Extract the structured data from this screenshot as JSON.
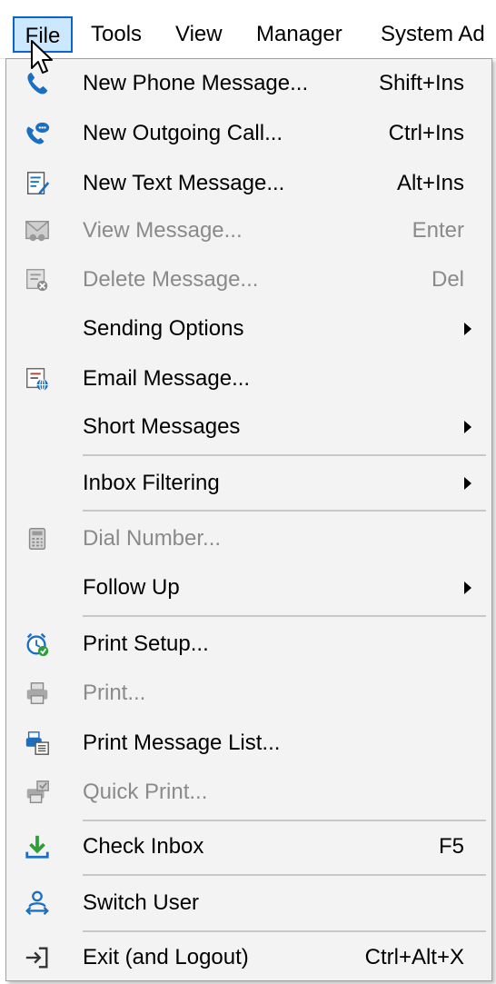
{
  "menubar": {
    "items": [
      "File",
      "Tools",
      "View",
      "Manager",
      "System Ad"
    ]
  },
  "colors": {
    "accent": "#0a64c9",
    "highlight": "#cce8ff",
    "disabled_text": "#8a8a8a",
    "icon_blue": "#1a6fc2",
    "icon_green": "#2e9d3a"
  },
  "menu": {
    "items": [
      {
        "label": "New Phone Message...",
        "shortcut": "Shift+Ins",
        "icon": "phone-icon",
        "enabled": true
      },
      {
        "label": "New Outgoing Call...",
        "shortcut": "Ctrl+Ins",
        "icon": "outgoing-call-icon",
        "enabled": true
      },
      {
        "label": "New Text Message...",
        "shortcut": "Alt+Ins",
        "icon": "text-message-icon",
        "enabled": true
      },
      {
        "label": "View Message...",
        "shortcut": "Enter",
        "icon": "view-message-icon",
        "enabled": false
      },
      {
        "label": "Delete Message...",
        "shortcut": "Del",
        "icon": "delete-message-icon",
        "enabled": false
      },
      {
        "label": "Sending Options",
        "shortcut": "",
        "icon": "",
        "enabled": true,
        "submenu": true
      },
      {
        "label": "Email Message...",
        "shortcut": "",
        "icon": "email-message-icon",
        "enabled": true
      },
      {
        "label": "Short Messages",
        "shortcut": "",
        "icon": "",
        "enabled": true,
        "submenu": true
      },
      {
        "label": "Inbox Filtering",
        "shortcut": "",
        "icon": "",
        "enabled": true,
        "submenu": true
      },
      {
        "label": "Dial Number...",
        "shortcut": "",
        "icon": "dial-pad-icon",
        "enabled": false
      },
      {
        "label": "Follow Up",
        "shortcut": "",
        "icon": "",
        "enabled": true,
        "submenu": true
      },
      {
        "label": "Print Setup...",
        "shortcut": "",
        "icon": "alarm-clock-icon",
        "enabled": true
      },
      {
        "label": "Print...",
        "shortcut": "",
        "icon": "printer-icon",
        "enabled": false
      },
      {
        "label": "Print Message List...",
        "shortcut": "",
        "icon": "print-list-icon",
        "enabled": true
      },
      {
        "label": "Quick Print...",
        "shortcut": "",
        "icon": "quick-print-icon",
        "enabled": false
      },
      {
        "label": "Check Inbox",
        "shortcut": "F5",
        "icon": "download-icon",
        "enabled": true
      },
      {
        "label": "Switch User",
        "shortcut": "",
        "icon": "switch-user-icon",
        "enabled": true
      },
      {
        "label": "Exit (and Logout)",
        "shortcut": "Ctrl+Alt+X",
        "icon": "exit-icon",
        "enabled": true
      }
    ]
  }
}
